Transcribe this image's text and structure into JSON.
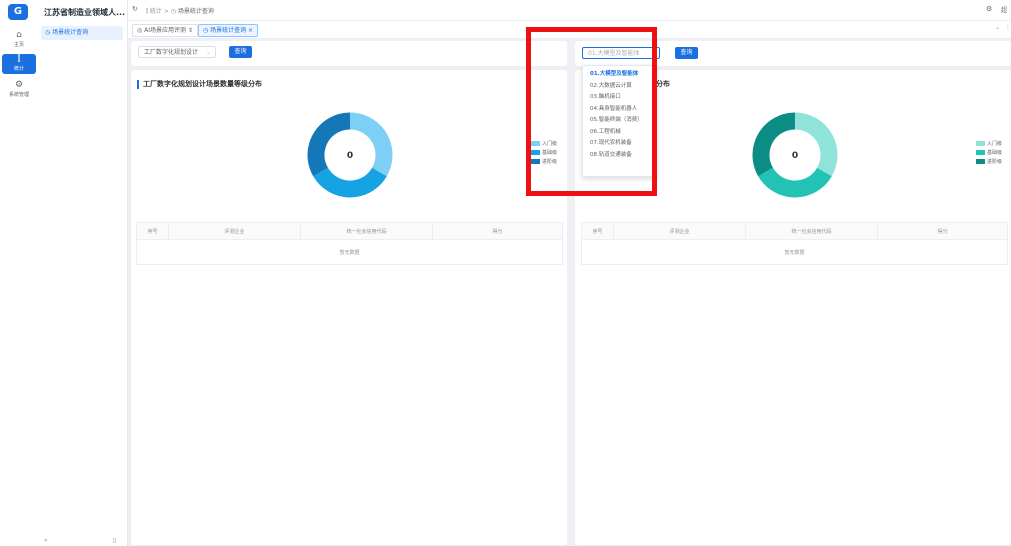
{
  "rail": {
    "logo": "G",
    "items": [
      {
        "icon": "⌂",
        "label": "主页"
      },
      {
        "icon": "⫿",
        "label": "统计"
      },
      {
        "icon": "⚙",
        "label": "系统管理"
      }
    ]
  },
  "sidebar": {
    "app_title": "江苏省制造业领域人...",
    "items": [
      {
        "label": "◷ 场景统计查询"
      }
    ],
    "collapse": "«",
    "pin": "▯"
  },
  "header": {
    "refresh": "↻",
    "breadcrumb": [
      "统计",
      "场景统计查询"
    ],
    "breadcrumb_sep": ">",
    "breadcrumb_icons": [
      "⫿",
      "◷"
    ],
    "settings_icon": "⚙",
    "user": "超"
  },
  "tabs": [
    {
      "label": "◎ AI场景应用评测 ⇕",
      "active": false
    },
    {
      "label": "◷ 场景统计查询 ×",
      "active": true
    }
  ],
  "tab_controls": {
    "chevron": "⌄",
    "more": "⋮"
  },
  "left_panel": {
    "select_value": "工厂数字化规划设计",
    "select_arrow": "⌄",
    "query_button": "查询",
    "section_title": "工厂数字化规划设计场景数量等级分布",
    "center_value": "0",
    "legend": [
      {
        "label": "入门级",
        "color": "#7dcff5"
      },
      {
        "label": "基础级",
        "color": "#16a3e3"
      },
      {
        "label": "进阶级",
        "color": "#1576b8"
      }
    ],
    "table": {
      "columns": [
        "序号",
        "评测企业",
        "统一社会信用代码",
        "得分"
      ],
      "empty_text": "暂无数据"
    }
  },
  "right_panel": {
    "select_placeholder": "01.大模型及智能体",
    "query_button": "查询",
    "section_title_suffix": "分布",
    "center_value": "0",
    "legend": [
      {
        "label": "入门级",
        "color": "#8fe3d8"
      },
      {
        "label": "基础级",
        "color": "#22c3b5"
      },
      {
        "label": "进阶级",
        "color": "#0b8d86"
      }
    ],
    "table": {
      "columns": [
        "序号",
        "评测企业",
        "统一社会信用代码",
        "得分"
      ],
      "empty_text": "暂无数据"
    }
  },
  "dropdown": {
    "options": [
      "01.大模型及智能体",
      "02.大数据云计算",
      "03.脑机接口",
      "04.具身智能机器人",
      "05.智能终端（消费）",
      "06.工程机械",
      "07.现代农机装备",
      "08.轨道交通装备"
    ],
    "selected_index": 0
  },
  "colors": {
    "accent": "#1b6fe0",
    "highlight": "#ee1111"
  }
}
